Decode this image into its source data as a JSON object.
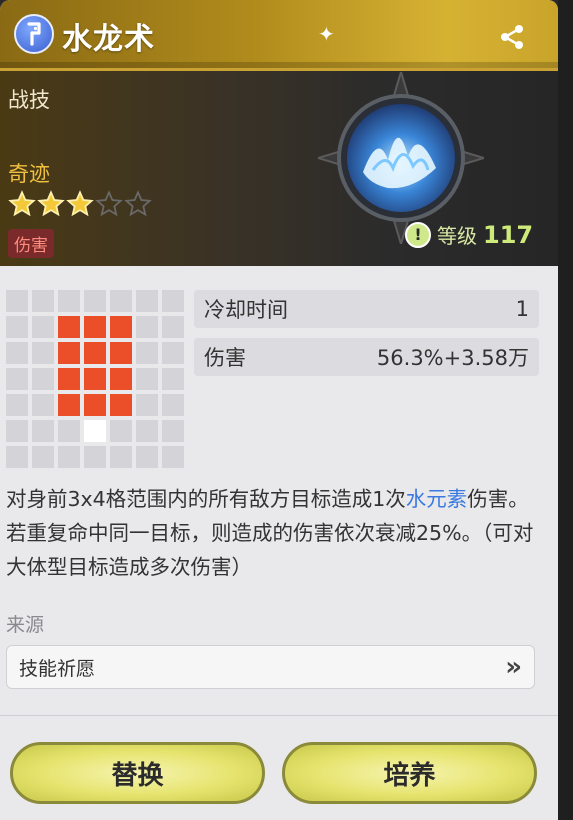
{
  "header": {
    "title": "水龙术"
  },
  "hero": {
    "category": "战技",
    "rarity_label": "奇迹",
    "stars_filled": 3,
    "stars_total": 5,
    "tag": "伤害",
    "level_label": "等级",
    "level_value": "117"
  },
  "range_grid": {
    "cols": 7,
    "rows": 7,
    "hit_cells": [
      [
        2,
        1
      ],
      [
        3,
        1
      ],
      [
        4,
        1
      ],
      [
        2,
        2
      ],
      [
        3,
        2
      ],
      [
        4,
        2
      ],
      [
        2,
        3
      ],
      [
        3,
        3
      ],
      [
        4,
        3
      ],
      [
        2,
        4
      ],
      [
        3,
        4
      ],
      [
        4,
        4
      ]
    ],
    "self_cell": [
      3,
      5
    ]
  },
  "stats": [
    {
      "label": "冷却时间",
      "value": "1"
    },
    {
      "label": "伤害",
      "value": "56.3%+3.58万"
    }
  ],
  "description": {
    "part1": "对身前3x4格范围内的所有敌方目标造成1次",
    "highlight": "水元素",
    "part2": "伤害。若重复命中同一目标，则造成的伤害依次衰减25%。（可对大体型目标造成多次伤害）"
  },
  "source": {
    "label": "来源",
    "item": "技能祈愿",
    "arrow": "»"
  },
  "buttons": {
    "replace": "替换",
    "train": "培养"
  },
  "colors": {
    "accent_gold": "#c9a233",
    "hit": "#ea4f2a",
    "highlight": "#3a7ae0",
    "button": "#e6e46e"
  }
}
